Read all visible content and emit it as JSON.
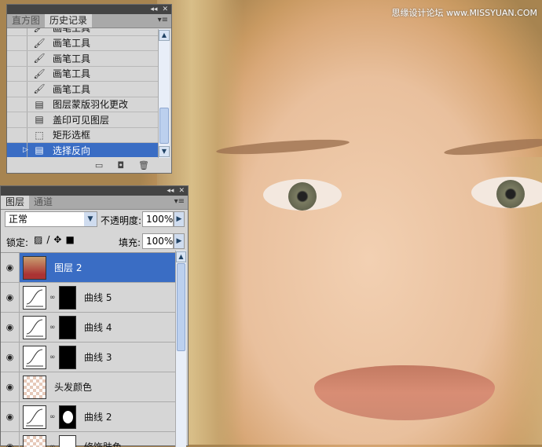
{
  "watermark": "思缘设计论坛 www.MISSYUAN.COM",
  "history": {
    "tabs": [
      "直方图",
      "历史记录"
    ],
    "items": [
      {
        "icon": "brush-icon",
        "label": "画笔工具"
      },
      {
        "icon": "brush-icon",
        "label": "画笔工具"
      },
      {
        "icon": "brush-icon",
        "label": "画笔工具"
      },
      {
        "icon": "brush-icon",
        "label": "画笔工具"
      },
      {
        "icon": "brush-icon",
        "label": "画笔工具"
      },
      {
        "icon": "document-icon",
        "label": "图层蒙版羽化更改"
      },
      {
        "icon": "document-icon",
        "label": "盖印可见图层"
      },
      {
        "icon": "marquee-icon",
        "label": "矩形选框"
      },
      {
        "icon": "document-icon",
        "label": "选择反向",
        "selected": true
      }
    ]
  },
  "layers": {
    "tabs": [
      "图层",
      "通道"
    ],
    "blend_mode": "正常",
    "opacity_label": "不透明度:",
    "opacity": "100%",
    "lock_label": "锁定:",
    "fill_label": "填充:",
    "fill": "100%",
    "items": [
      {
        "name": "图层 2",
        "type": "image",
        "selected": true
      },
      {
        "name": "曲线 5",
        "type": "curves"
      },
      {
        "name": "曲线 4",
        "type": "curves"
      },
      {
        "name": "曲线 3",
        "type": "curves"
      },
      {
        "name": "头发颜色",
        "type": "fill"
      },
      {
        "name": "曲线 2",
        "type": "curves"
      },
      {
        "name": "修饰肤色",
        "type": "fill-mask"
      }
    ]
  },
  "accent": "#3a6dc4"
}
